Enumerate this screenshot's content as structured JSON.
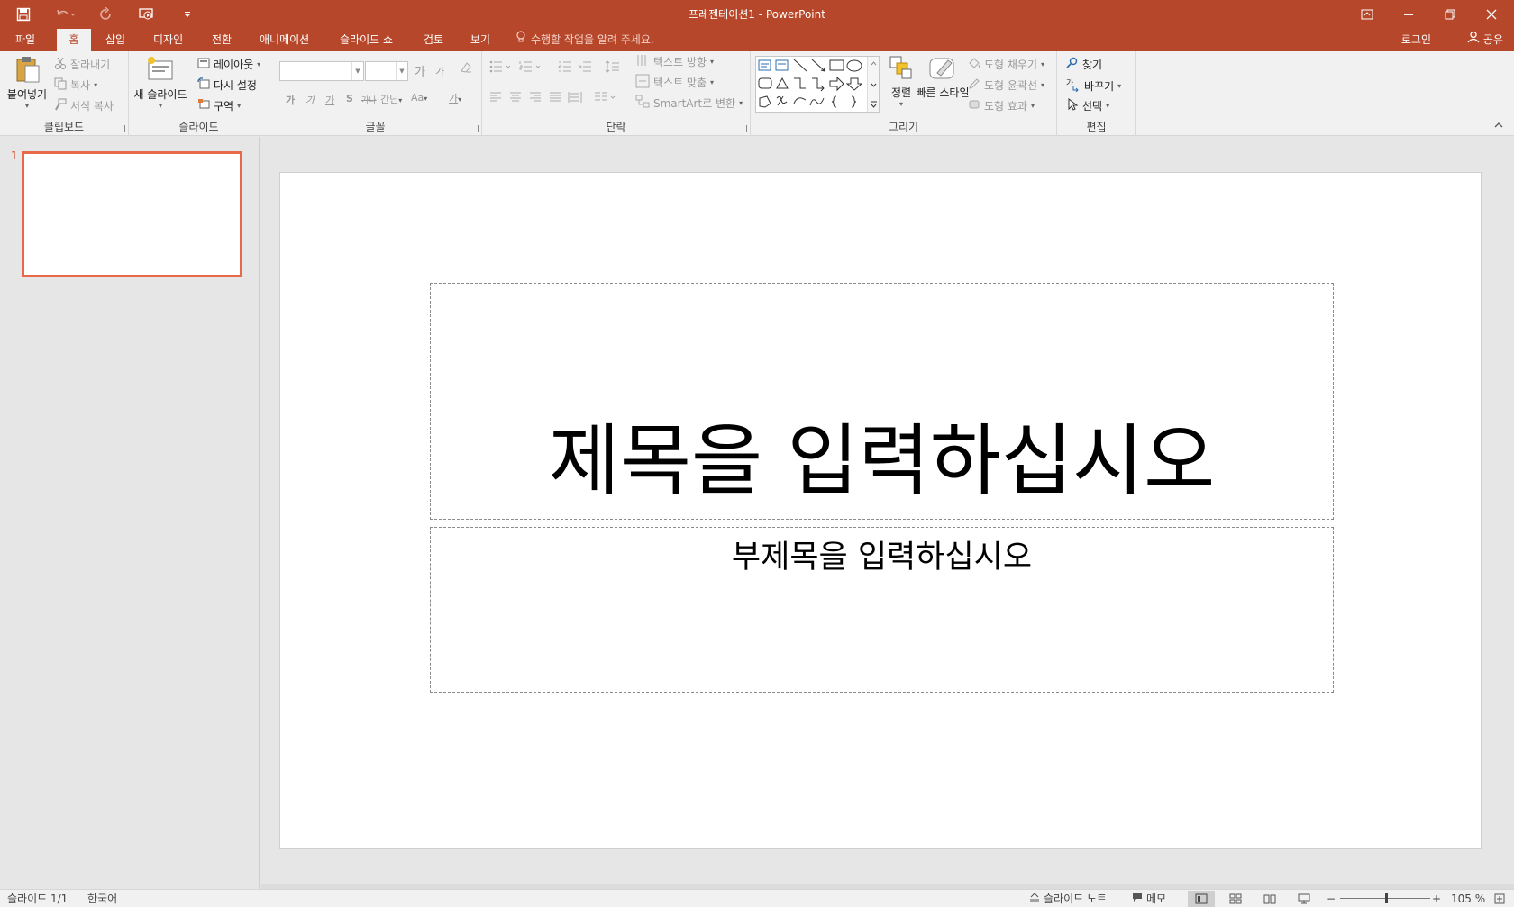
{
  "window": {
    "title": "프레젠테이션1 - PowerPoint",
    "accent_color": "#b7472a",
    "quick_access": [
      "save-icon",
      "undo-icon",
      "redo-icon",
      "present-from-start-icon",
      "customize-icon"
    ]
  },
  "tabs": [
    {
      "label": "파일"
    },
    {
      "label": "홈",
      "active": true
    },
    {
      "label": "삽입"
    },
    {
      "label": "디자인"
    },
    {
      "label": "전환"
    },
    {
      "label": "애니메이션"
    },
    {
      "label": "슬라이드 쇼"
    },
    {
      "label": "검토"
    },
    {
      "label": "보기"
    }
  ],
  "tellme": "수행할 작업을 알려 주세요.",
  "signin": "로그인",
  "share": "공유",
  "ribbon": {
    "clipboard": {
      "label": "클립보드",
      "paste": "붙여넣기",
      "cut": "잘라내기",
      "copy": "복사",
      "format_painter": "서식 복사"
    },
    "slides": {
      "label": "슬라이드",
      "new_slide": "새 슬라이드",
      "layout": "레이아웃",
      "reset": "다시 설정",
      "section": "구역"
    },
    "font": {
      "label": "글꼴",
      "font_name": "",
      "font_size": "",
      "grow": "가",
      "shrink": "가",
      "bold": "가",
      "italic": "가",
      "underline": "가",
      "shadow": "S",
      "strike": "가나",
      "spacing": "간닌",
      "case": "Aa",
      "color": "가"
    },
    "paragraph": {
      "label": "단락",
      "text_direction": "텍스트 방향",
      "align_text": "텍스트 맞춤",
      "smartart": "SmartArt로 변환"
    },
    "drawing": {
      "label": "그리기",
      "arrange": "정렬",
      "quick_styles": "빠른 스타일",
      "shape_fill": "도형 채우기",
      "shape_outline": "도형 윤곽선",
      "shape_effects": "도형 효과"
    },
    "editing": {
      "label": "편집",
      "find": "찾기",
      "replace": "바꾸기",
      "select": "선택"
    }
  },
  "thumbnails": [
    {
      "number": "1"
    }
  ],
  "slide": {
    "title_placeholder": "제목을 입력하십시오",
    "subtitle_placeholder": "부제목을 입력하십시오"
  },
  "status": {
    "slide_indicator": "슬라이드 1/1",
    "language": "한국어",
    "notes": "슬라이드 노트",
    "comments": "메모",
    "zoom": "105 %",
    "zoom_percent": 105
  }
}
